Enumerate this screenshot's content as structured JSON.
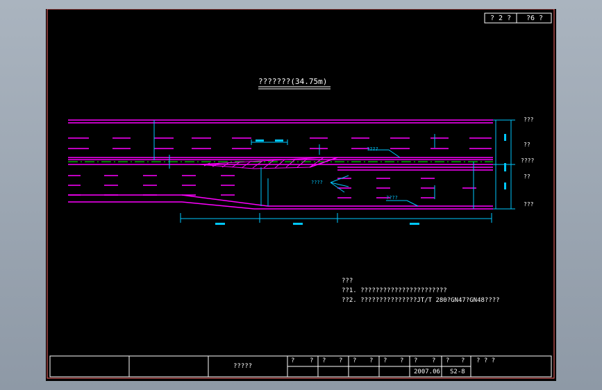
{
  "sheet": {
    "corner_left": "? 2 ?",
    "corner_right": "?6 ?"
  },
  "title": "???????(34.75m)",
  "labels": {
    "right_top": "???",
    "right_mid1": "??",
    "right_mid2": "????",
    "right_mid3": "??",
    "right_bot": "???",
    "callout_upper": "????",
    "callout_lower": "????",
    "callout_bottom": "????"
  },
  "notes": {
    "heading": "???",
    "line1": "??1. ???????????????????????",
    "line2": "??2. ???????????????JT/T 280?GN47?GN48????"
  },
  "title_block": {
    "drawing_name": "?????",
    "h1": "?",
    "h2": "?",
    "h3": "?",
    "h4": "?",
    "h5": "?",
    "h6": "?",
    "h7": "?",
    "h8": "?",
    "h9": "?",
    "h10": "?",
    "h11": "?",
    "h12": "?",
    "h13": "? ? ?",
    "date": "2007.06",
    "sheet_no": "S2-8"
  },
  "colors": {
    "magenta": "#ff00ff",
    "cyan": "#00c8ff",
    "white": "#ffffff",
    "green": "#00ff00",
    "frame": "#ff6a6a"
  }
}
